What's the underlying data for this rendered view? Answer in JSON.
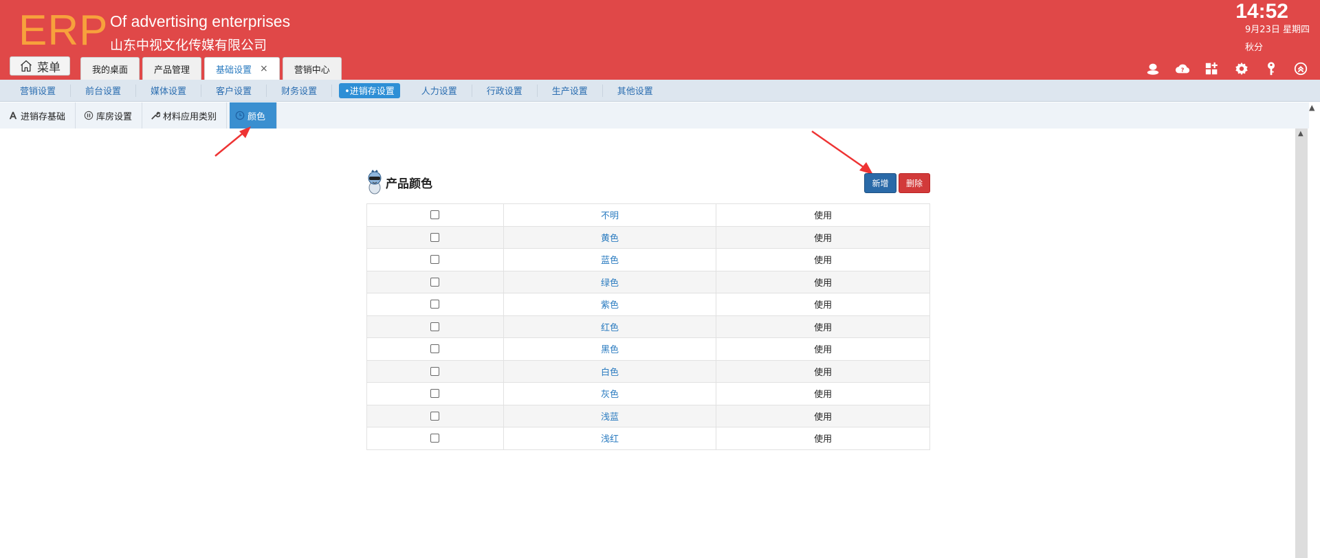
{
  "header": {
    "logo": "ERP",
    "brand_en": "Of advertising enterprises",
    "brand_cn": "山东中视文化传媒有限公司",
    "time": "14:52",
    "date": "9月23日 星期四",
    "season": "秋分"
  },
  "menu_button": {
    "label": "菜单",
    "icon": "home-icon"
  },
  "tabs": [
    {
      "label": "我的桌面",
      "active": false
    },
    {
      "label": "产品管理",
      "active": false
    },
    {
      "label": "基础设置",
      "active": true,
      "closable": true
    },
    {
      "label": "营销中心",
      "active": false
    }
  ],
  "header_icons": [
    "user-icon",
    "cloud-help-icon",
    "grid-add-icon",
    "gear-icon",
    "key-icon",
    "collapse-up-icon"
  ],
  "nav1": [
    {
      "label": "营销设置"
    },
    {
      "label": "前台设置"
    },
    {
      "label": "媒体设置"
    },
    {
      "label": "客户设置"
    },
    {
      "label": "财务设置"
    },
    {
      "label": "•进销存设置",
      "active": true
    },
    {
      "label": "人力设置"
    },
    {
      "label": "行政设置"
    },
    {
      "label": "生产设置"
    },
    {
      "label": "其他设置"
    }
  ],
  "nav2": [
    {
      "label": "进销存基础",
      "icon": "font-a-icon"
    },
    {
      "label": "库房设置",
      "icon": "pause-circle-icon"
    },
    {
      "label": "材料应用类别",
      "icon": "wrench-icon"
    },
    {
      "label": "颜色",
      "icon": "clock-icon",
      "active": true
    }
  ],
  "panel": {
    "title": "产品颜色",
    "add_label": "新增",
    "delete_label": "删除"
  },
  "rows": [
    {
      "name": "不明",
      "status": "使用"
    },
    {
      "name": "黄色",
      "status": "使用"
    },
    {
      "name": "蓝色",
      "status": "使用"
    },
    {
      "name": "绿色",
      "status": "使用"
    },
    {
      "name": "紫色",
      "status": "使用"
    },
    {
      "name": "红色",
      "status": "使用"
    },
    {
      "name": "黑色",
      "status": "使用"
    },
    {
      "name": "白色",
      "status": "使用"
    },
    {
      "name": "灰色",
      "status": "使用"
    },
    {
      "name": "浅蓝",
      "status": "使用"
    },
    {
      "name": "浅红",
      "status": "使用"
    }
  ],
  "colors": {
    "header_bg": "#e04848",
    "logo": "#f7a13c",
    "accent": "#2e8fd6",
    "add_btn": "#2a6aa8",
    "delete_btn": "#d23a3a"
  }
}
